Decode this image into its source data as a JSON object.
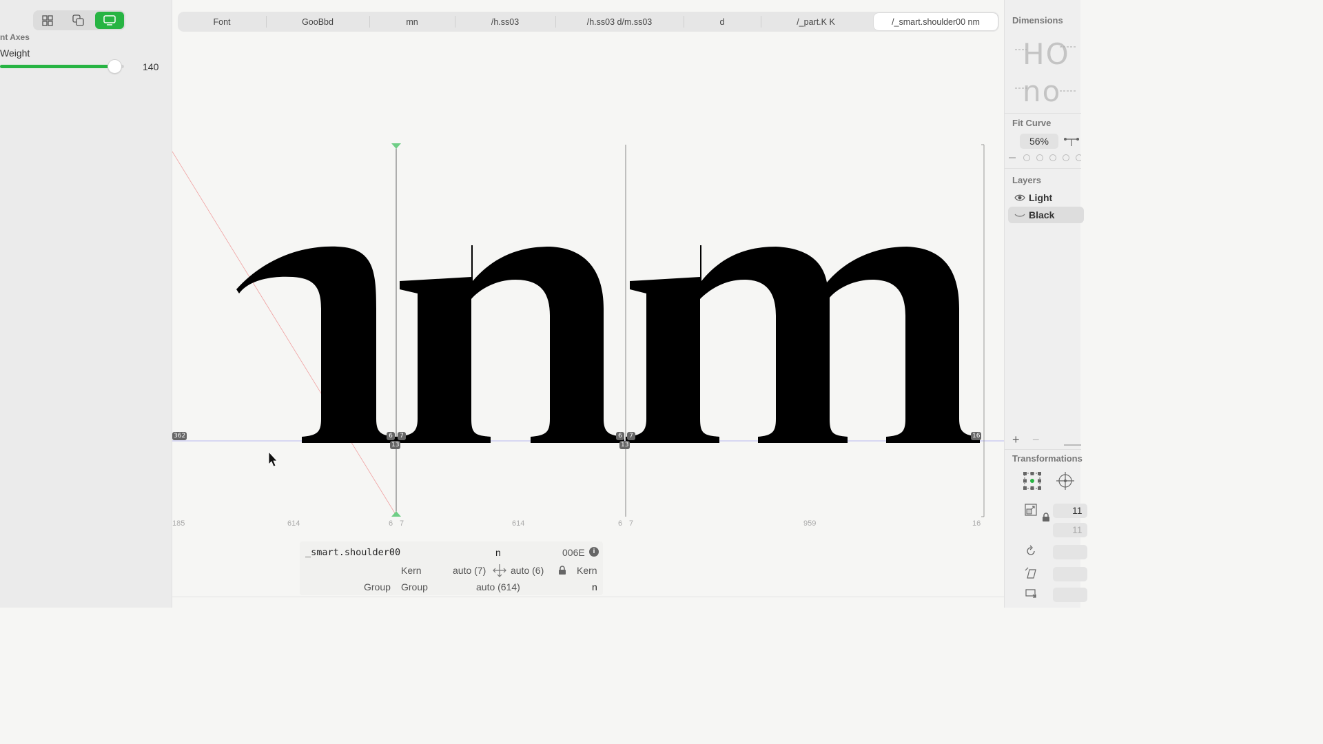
{
  "left_panel": {
    "axes_title": "nt Axes",
    "axis_label": "Weight",
    "axis_value": "140",
    "axis_fraction": 0.92
  },
  "tabs": [
    {
      "label": "Font"
    },
    {
      "label": "GooBbd"
    },
    {
      "label": "mn"
    },
    {
      "label": "/h.ss03"
    },
    {
      "label": "/h.ss03 d/m.ss03"
    },
    {
      "label": "d"
    },
    {
      "label": "/_part.K K"
    },
    {
      "label": "/_smart.shoulder00 nm",
      "active": true
    }
  ],
  "canvas": {
    "glyph_text": "nm",
    "left_number": "362",
    "badges": [
      "6",
      "7",
      "13",
      "6",
      "7",
      "13",
      "16"
    ],
    "metrics": [
      "185",
      "614",
      "6",
      "7",
      "614",
      "6",
      "7",
      "959",
      "16"
    ]
  },
  "info": {
    "glyph_name": "_smart.shoulder00",
    "char": "n",
    "unicode": "006E",
    "kern_left": "Kern",
    "kern_left_value": "auto (7)",
    "kern_right_value": "auto (6)",
    "kern_right": "Kern",
    "group_left": "Group",
    "group_left2": "Group",
    "width_value": "auto (614)",
    "group_right": "n"
  },
  "right_panel": {
    "dimensions_title": "Dimensions",
    "dim_preview_1": "HO",
    "dim_preview_2": "no",
    "fit_curve_title": "Fit Curve",
    "fit_curve_value": "56%",
    "layers_title": "Layers",
    "layers": [
      {
        "name": "Light",
        "active": false
      },
      {
        "name": "Black",
        "active": true
      }
    ],
    "transformations_title": "Transformations",
    "field_value_1": "11",
    "field_value_2": "11"
  },
  "colors": {
    "accent": "#27b443",
    "glyph": "#000000",
    "guide": "#c0c0ff"
  }
}
